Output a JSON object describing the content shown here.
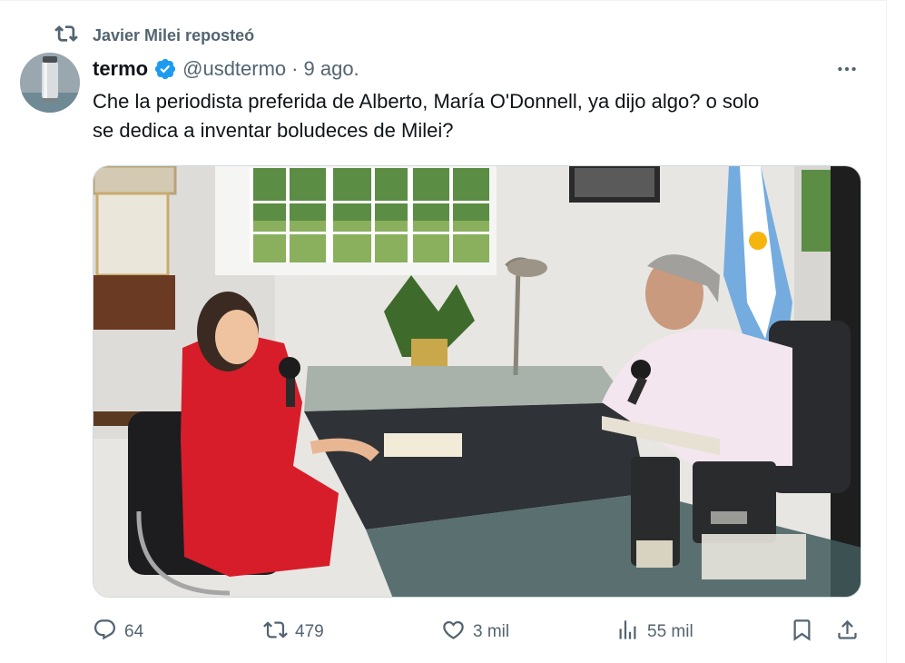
{
  "repost": {
    "text": "Javier Milei reposteó",
    "icon": "repost-icon"
  },
  "tweet": {
    "author_name": "termo",
    "handle": "@usdtermo",
    "separator": "·",
    "date": "9 ago.",
    "verified": true,
    "text": "Che la periodista preferida de Alberto, María O'Donnell, ya dijo algo? o solo\nse dedica a inventar boludeces de Milei?"
  },
  "actions": {
    "replies": "64",
    "reposts": "479",
    "likes": "3 mil",
    "views": "55 mil"
  },
  "colors": {
    "text_primary": "#0f1419",
    "text_secondary": "#536471",
    "verified_blue": "#1d9bf0",
    "border": "#cfd9de"
  }
}
